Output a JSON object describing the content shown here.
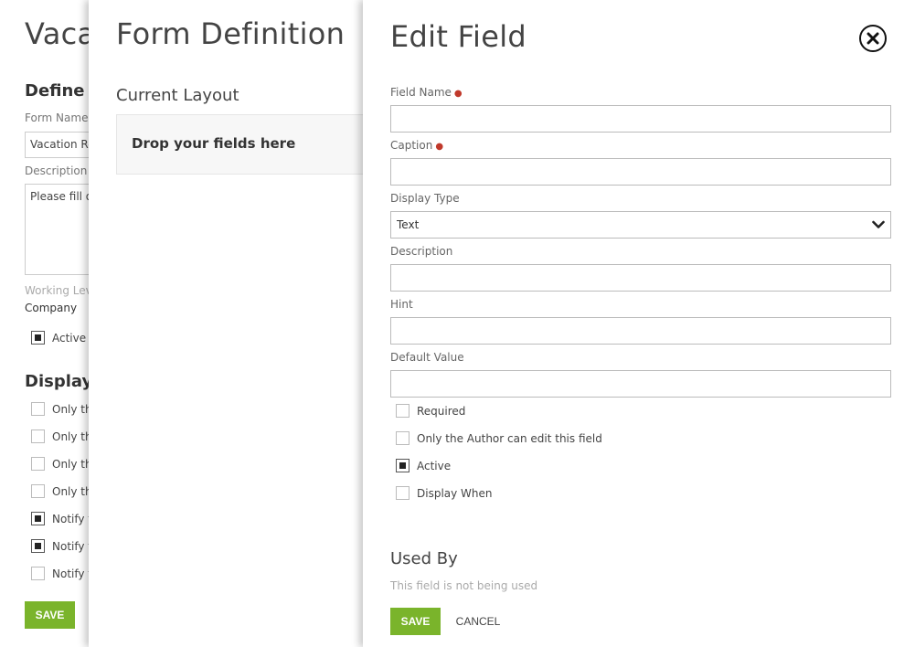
{
  "vacation_form": {
    "title": "Vacation Request",
    "define_section_title": "Define Form",
    "form_name_label": "Form Name",
    "form_name_value": "Vacation Request",
    "description_label": "Description",
    "description_value": "Please fill out",
    "working_level_label": "Working Level",
    "working_level_value": "Company",
    "active_label": "Active",
    "display_section_title": "Display",
    "options": [
      {
        "label": "Only the",
        "checked": false
      },
      {
        "label": "Only the",
        "checked": false
      },
      {
        "label": "Only the",
        "checked": false
      },
      {
        "label": "Only the",
        "checked": false
      },
      {
        "label": "Notify the",
        "checked": true
      },
      {
        "label": "Notify the",
        "checked": true
      },
      {
        "label": "Notify the",
        "checked": false
      }
    ],
    "save_label": "SAVE"
  },
  "form_definition": {
    "title": "Form Definition",
    "current_layout_title": "Current Layout",
    "dropzone_text": "Drop your fields here"
  },
  "edit_field": {
    "title": "Edit Field",
    "close_icon": "close-circle-icon",
    "field_name_label": "Field Name",
    "caption_label": "Caption",
    "display_type_label": "Display Type",
    "display_type_value": "Text",
    "description_label": "Description",
    "hint_label": "Hint",
    "default_value_label": "Default Value",
    "field_name_value": "",
    "caption_value": "",
    "description_value": "",
    "hint_value": "",
    "default_value": "",
    "checkboxes": [
      {
        "label": "Required",
        "checked": false
      },
      {
        "label": "Only the Author can edit this field",
        "checked": false
      },
      {
        "label": "Active",
        "checked": true
      },
      {
        "label": "Display When",
        "checked": false
      }
    ],
    "used_by_title": "Used By",
    "used_by_text": "This field is not being used",
    "save_label": "SAVE",
    "cancel_label": "CANCEL"
  },
  "colors": {
    "accent_green": "#7ab42b",
    "required_red": "#c0392b"
  }
}
